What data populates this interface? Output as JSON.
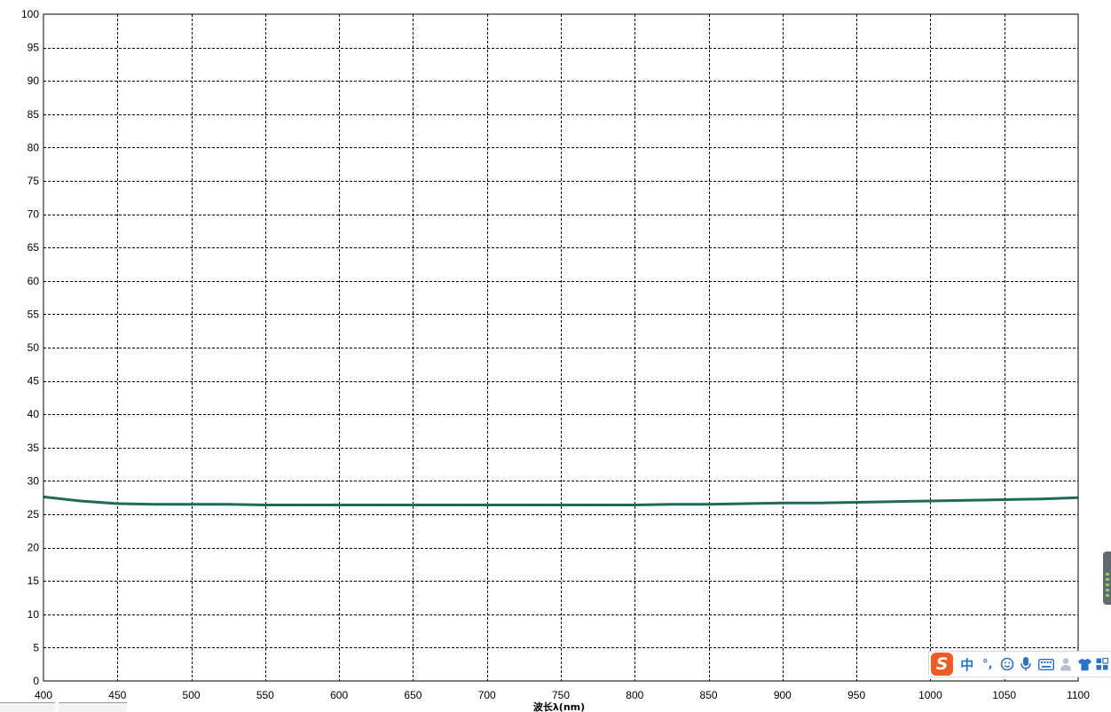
{
  "chart_data": {
    "type": "line",
    "title": "",
    "xlabel": "波长λ(nm)",
    "ylabel": "",
    "xlim": [
      400,
      1100
    ],
    "ylim": [
      0,
      100
    ],
    "x_ticks": [
      400,
      450,
      500,
      550,
      600,
      650,
      700,
      750,
      800,
      850,
      900,
      950,
      1000,
      1050,
      1100
    ],
    "y_ticks": [
      0,
      5,
      10,
      15,
      20,
      25,
      30,
      35,
      40,
      45,
      50,
      55,
      60,
      65,
      70,
      75,
      80,
      85,
      90,
      95,
      100
    ],
    "grid": true,
    "grid_style": "dashed",
    "series": [
      {
        "color": "#1f6b58",
        "x": [
          400,
          425,
          450,
          475,
          500,
          525,
          550,
          575,
          600,
          625,
          650,
          675,
          700,
          725,
          750,
          775,
          800,
          825,
          850,
          875,
          900,
          925,
          950,
          975,
          1000,
          1025,
          1050,
          1075,
          1100
        ],
        "y": [
          27.6,
          27.0,
          26.6,
          26.5,
          26.5,
          26.5,
          26.4,
          26.4,
          26.4,
          26.4,
          26.4,
          26.4,
          26.4,
          26.4,
          26.4,
          26.4,
          26.4,
          26.5,
          26.5,
          26.6,
          26.7,
          26.7,
          26.8,
          26.9,
          27.0,
          27.1,
          27.2,
          27.3,
          27.5
        ]
      }
    ]
  },
  "ime_toolbar": {
    "logo_glyph": "S",
    "mode_label": "中",
    "punct_label": "°,",
    "icons": [
      "smiley-icon",
      "microphone-icon",
      "keyboard-icon",
      "user-icon",
      "shirt-icon",
      "grid-icon"
    ]
  },
  "colors": {
    "series_line": "#1f6b58",
    "grid": "#000000",
    "ime_logo": "#f05a24",
    "ime_icon": "#2a72c8"
  }
}
